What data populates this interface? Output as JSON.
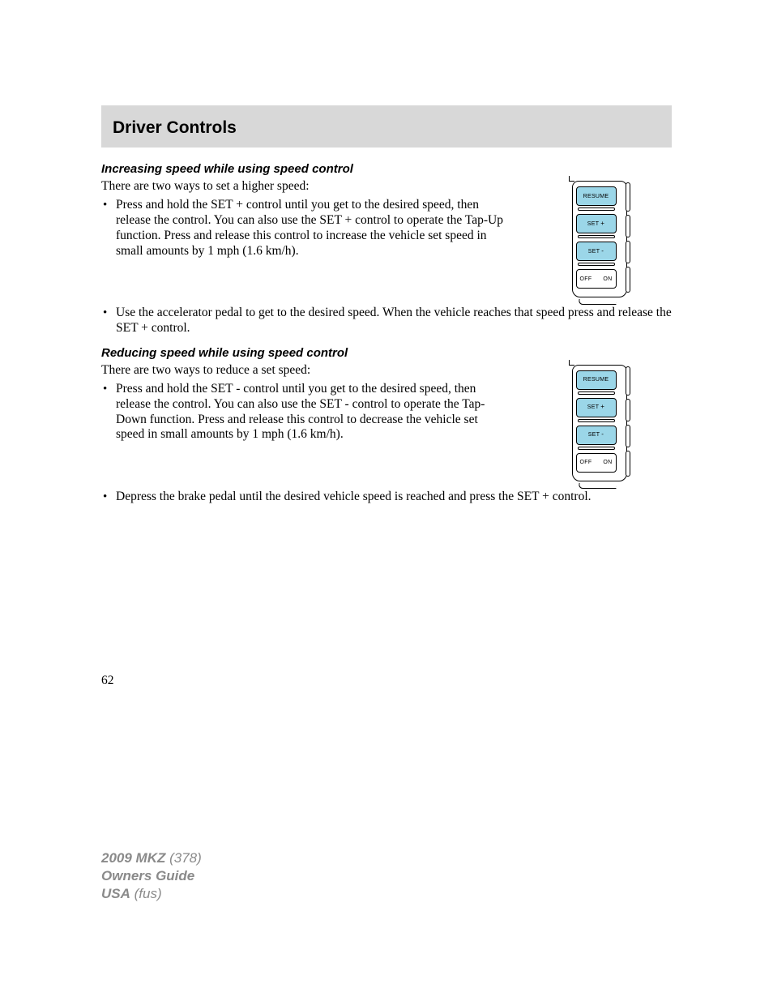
{
  "header": {
    "title": "Driver Controls"
  },
  "section1": {
    "heading": "Increasing speed while using speed control",
    "intro": "There are two ways to set a higher speed:",
    "bullet1": "Press and hold the SET + control until you get to the desired speed, then release the control. You can also use the SET + control to operate the Tap-Up function. Press and release this control to increase the vehicle set speed in small amounts by 1 mph (1.6 km/h).",
    "bullet2": "Use the accelerator pedal to get to the desired speed. When the vehicle reaches that speed press and release the SET + control."
  },
  "section2": {
    "heading": "Reducing speed while using speed control",
    "intro": "There are two ways to reduce a set speed:",
    "bullet1": "Press and hold the SET - control until you get to the desired speed, then release the control. You can also use the SET - control to operate the Tap-Down function. Press and release this control to decrease the vehicle set speed in small amounts by 1 mph (1.6 km/h).",
    "bullet2": "Depress the brake pedal until the desired vehicle speed is reached and press the SET + control."
  },
  "diagram": {
    "btn_resume": "RESUME",
    "btn_set_plus_label": "SET",
    "btn_set_plus_sign": "+",
    "btn_set_minus_label": "SET",
    "btn_set_minus_sign": "-",
    "btn_off": "OFF",
    "btn_on": "ON"
  },
  "page_number": "62",
  "footer": {
    "model": "2009 MKZ",
    "code": "(378)",
    "line2": "Owners Guide",
    "region": "USA",
    "region_code": "(fus)"
  }
}
